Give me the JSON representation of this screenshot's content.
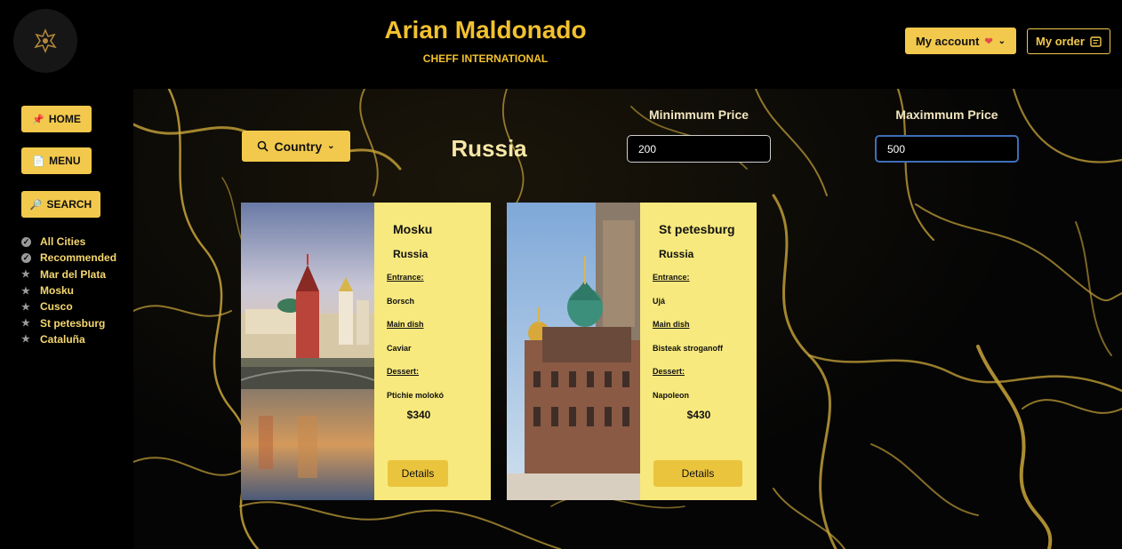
{
  "header": {
    "title": "Arian Maldonado",
    "subtitle": "CHEFF INTERNATIONAL",
    "account_label": "My account",
    "order_label": "My order"
  },
  "sidebar": {
    "home_label": "HOME",
    "menu_label": "MENU",
    "search_label": "SEARCH",
    "items": [
      {
        "label": "All Cities",
        "icon": "check-circle-icon"
      },
      {
        "label": "Recommended",
        "icon": "check-circle-icon"
      },
      {
        "label": "Mar del Plata",
        "icon": "star-icon"
      },
      {
        "label": "Mosku",
        "icon": "star-icon"
      },
      {
        "label": "Cusco",
        "icon": "star-icon"
      },
      {
        "label": "St petesburg",
        "icon": "star-icon"
      },
      {
        "label": "Cataluña",
        "icon": "star-icon"
      }
    ]
  },
  "filters": {
    "country_label": "Country",
    "selected_country": "Russia",
    "min_label": "Minimmum Price",
    "min_value": "200",
    "max_label": "Maximmum Price",
    "max_value": "500"
  },
  "cards": [
    {
      "city": "Mosku",
      "country": "Russia",
      "entrance_label": "Entrance:",
      "entrance": "Borsch",
      "main_label": "Main dish",
      "main": "Caviar",
      "dessert_label": "Dessert:",
      "dessert": "Ptichie molokó",
      "price": "$340",
      "details_label": "Details"
    },
    {
      "city": "St petesburg",
      "country": "Russia",
      "entrance_label": "Entrance:",
      "entrance": "Ujá",
      "main_label": "Main dish",
      "main": "Bisteak stroganoff",
      "dessert_label": "Dessert:",
      "dessert": "Napoleon",
      "price": "$430",
      "details_label": "Details"
    }
  ],
  "colors": {
    "accent": "#f2c94c",
    "card_bg": "#f7e97d",
    "vein_gold": "#c9a53a"
  }
}
